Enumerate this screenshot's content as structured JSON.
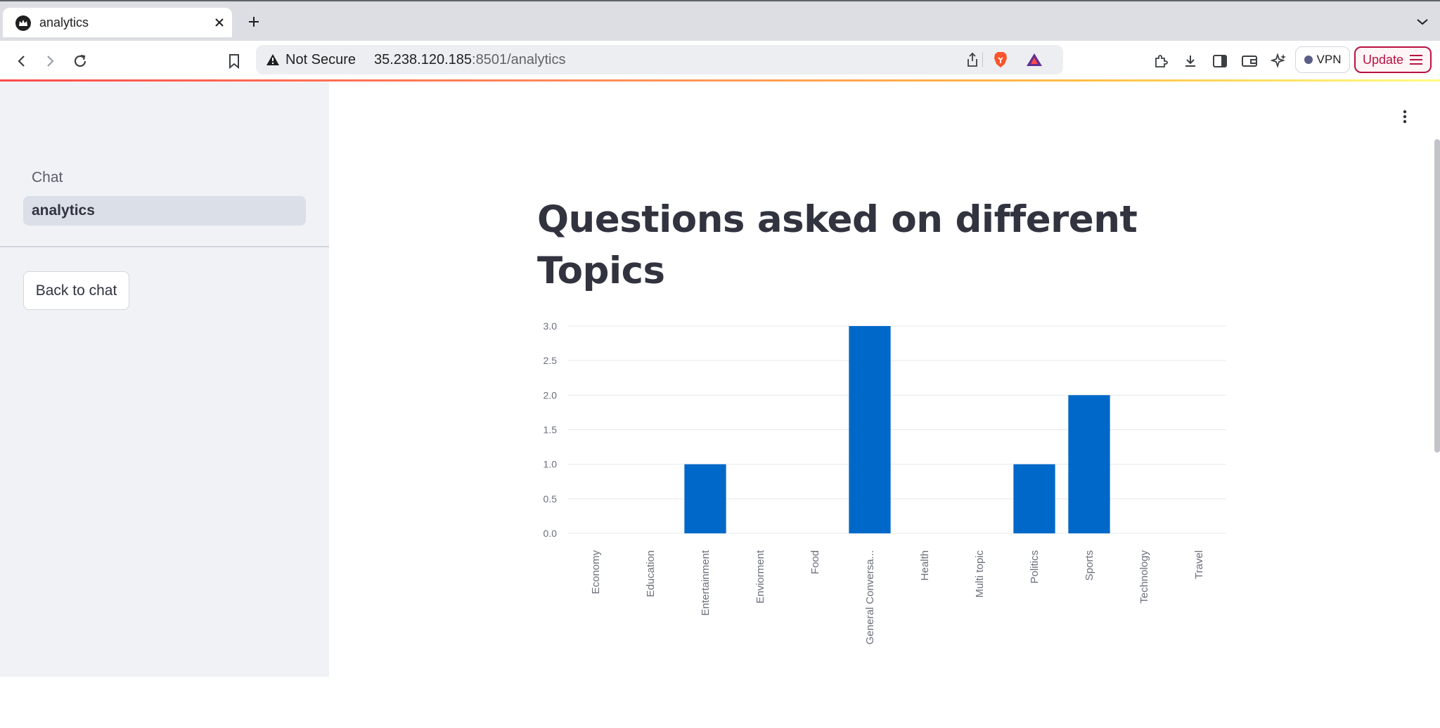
{
  "browser": {
    "tab_title": "analytics",
    "security_label": "Not Secure",
    "url_host": "35.238.120.185",
    "url_rest": ":8501/analytics",
    "vpn_label": "VPN",
    "update_label": "Update"
  },
  "sidebar": {
    "nav": [
      {
        "label": "Chat",
        "active": false
      },
      {
        "label": "analytics",
        "active": true
      }
    ],
    "back_button": "Back to chat"
  },
  "main": {
    "title": "Questions asked on different Topics"
  },
  "colors": {
    "bar": "#0068c9",
    "accent": "#ff4b4b",
    "sidebar_bg": "#f0f2f6",
    "active_nav_bg": "#dadfe8"
  },
  "chart_data": {
    "type": "bar",
    "title": "",
    "xlabel": "",
    "ylabel": "",
    "categories": [
      "Economy",
      "Education",
      "Entertainment",
      "Enviorment",
      "Food",
      "General Conversa...",
      "Health",
      "Multi topic",
      "Politics",
      "Sports",
      "Technology",
      "Travel"
    ],
    "values": [
      0,
      0,
      1,
      0,
      0,
      3,
      0,
      0,
      1,
      2,
      0,
      0
    ],
    "ylim": [
      0,
      3
    ],
    "yticks": [
      "0.0",
      "0.5",
      "1.0",
      "1.5",
      "2.0",
      "2.5",
      "3.0"
    ],
    "grid": true
  }
}
